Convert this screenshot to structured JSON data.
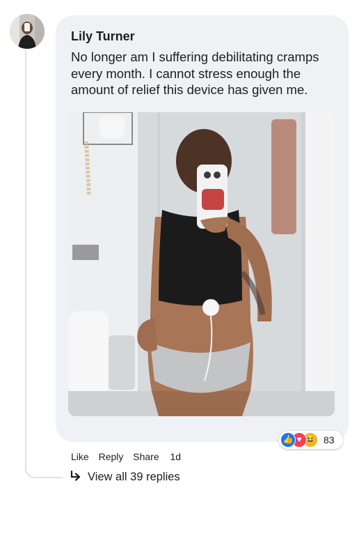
{
  "comment": {
    "author": "Lily Turner",
    "text": "No longer am I suffering debilitating cramps every month. I cannot stress enough the amount of relief this device has given me.",
    "image_alt_icon": "comment-photo"
  },
  "reactions": {
    "types": [
      "like",
      "love",
      "haha"
    ],
    "like_glyph": "👍",
    "love_glyph": "♥",
    "haha_glyph": "😆",
    "count": "83",
    "colors": {
      "like": "#1877f2",
      "love": "#f33e58",
      "haha": "#f7b125"
    }
  },
  "actions": {
    "like_label": "Like",
    "reply_label": "Reply",
    "share_label": "Share",
    "timestamp": "1d"
  },
  "replies": {
    "view_all_label": "View all 39 replies",
    "arrow_icon": "reply-arrow-icon"
  },
  "colors": {
    "bubble_background": "#f0f1f5",
    "text": "#1c1e21",
    "thread_line": "#dfe1e5"
  }
}
